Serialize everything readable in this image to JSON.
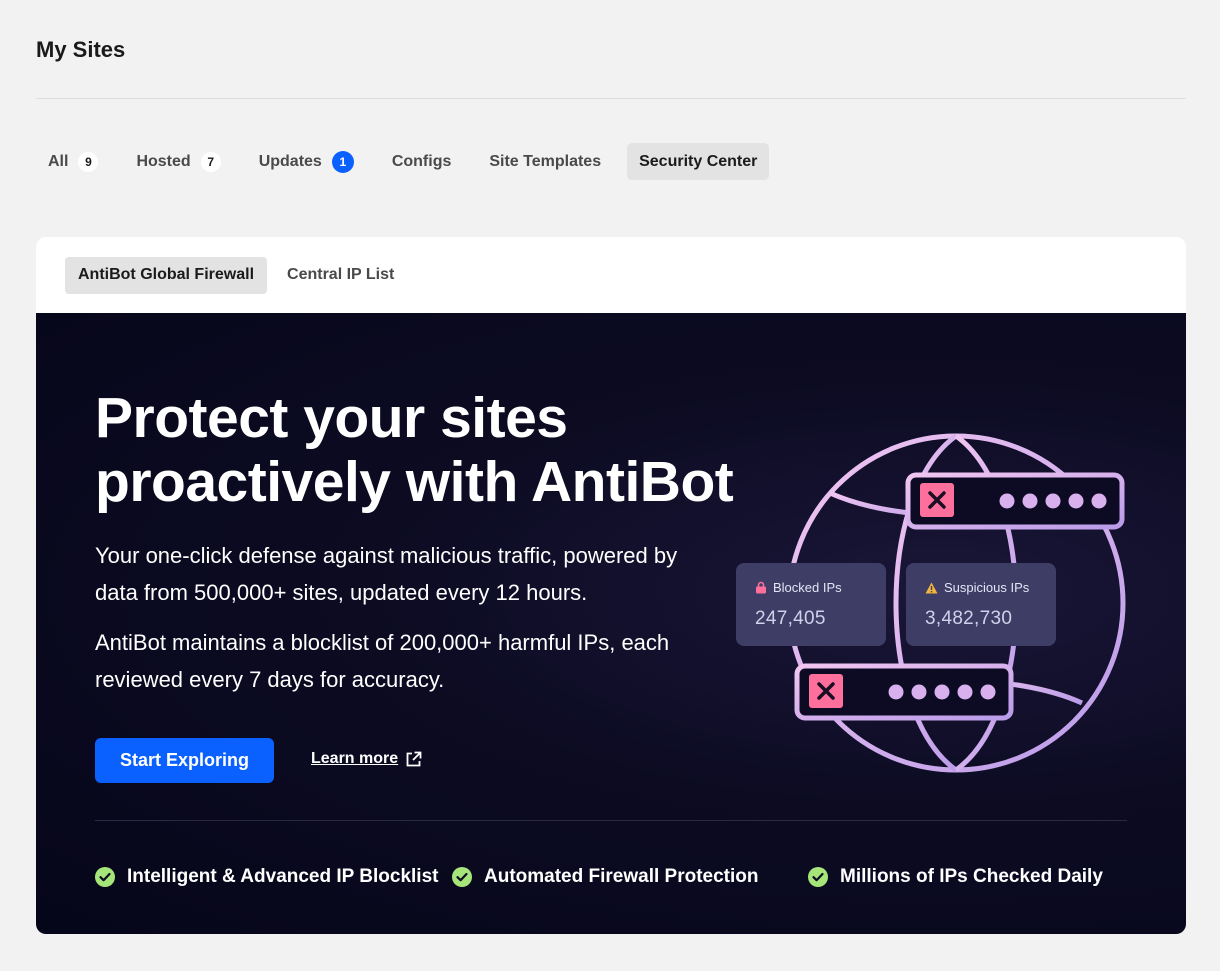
{
  "header": {
    "title": "My Sites"
  },
  "tabs": [
    {
      "label": "All",
      "count": "9"
    },
    {
      "label": "Hosted",
      "count": "7"
    },
    {
      "label": "Updates",
      "count": "1"
    },
    {
      "label": "Configs"
    },
    {
      "label": "Site Templates"
    },
    {
      "label": "Security Center",
      "active": true
    }
  ],
  "subtabs": [
    {
      "label": "AntiBot Global Firewall",
      "active": true
    },
    {
      "label": "Central IP List"
    }
  ],
  "hero": {
    "headline_line1": "Protect your sites",
    "headline_line2": "proactively with AntiBot",
    "paragraph1": "Your one-click defense against malicious traffic, powered by data from 500,000+ sites, updated every 12 hours.",
    "paragraph2": "AntiBot maintains a blocklist of 200,000+ harmful IPs, each reviewed every 7 days for accuracy.",
    "cta_label": "Start Exploring",
    "learn_more_label": "Learn more",
    "features": [
      "Intelligent & Advanced IP Blocklist",
      "Automated Firewall Protection",
      "Millions of IPs Checked Daily"
    ]
  },
  "stats": {
    "blocked": {
      "label": "Blocked IPs",
      "value": "247,405",
      "icon": "lock-icon"
    },
    "suspicious": {
      "label": "Suspicious IPs",
      "value": "3,482,730",
      "icon": "warning-icon"
    }
  },
  "colors": {
    "accent": "#0b61ff",
    "hero_bg": "#06061a",
    "check_green": "#a6e57a",
    "globe_pink": "#e9b8ee",
    "block_x_pink": "#ff6f9c"
  }
}
